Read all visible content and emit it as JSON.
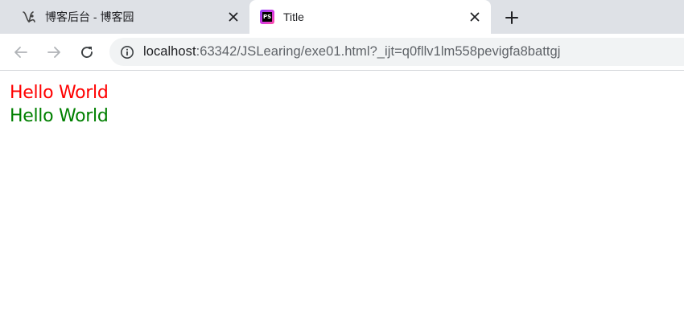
{
  "browser": {
    "tabs": [
      {
        "title": "博客后台 - 博客园",
        "icon": "cnblogs-logo-icon",
        "active": false
      },
      {
        "title": "Title",
        "icon": "phpstorm-icon",
        "icon_text": "PS",
        "active": true
      }
    ],
    "address": {
      "host": "localhost",
      "rest": ":63342/JSLearing/exe01.html?_ijt=q0fllv1lm558pevigfa8battgj"
    }
  },
  "page": {
    "lines": [
      {
        "text": "Hello World",
        "color": "#ff0000"
      },
      {
        "text": "Hello World",
        "color": "#008000"
      }
    ]
  }
}
